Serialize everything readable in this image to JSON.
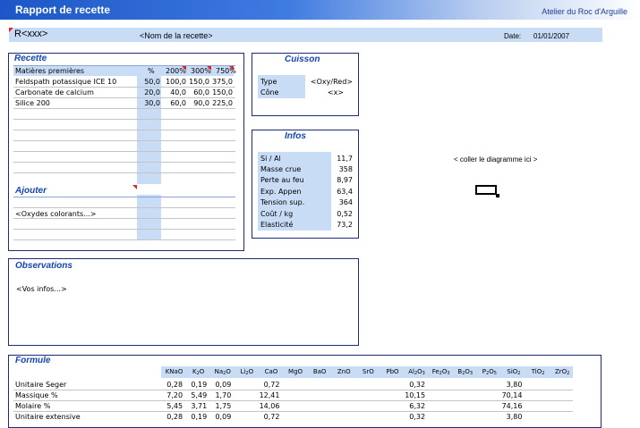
{
  "header": {
    "title": "Rapport de recette",
    "workshop": "Atelier du Roc d'Arguille"
  },
  "recipe_header": {
    "code": "R<xxx>",
    "name": "<Nom de la recette>",
    "date_label": "Date:",
    "date_value": "01/01/2007"
  },
  "recette": {
    "title": "Recette",
    "columns": [
      "Matières premières",
      "%",
      "200%",
      "300%",
      "750%"
    ],
    "rows": [
      [
        "Feldspath potassique ICE 10",
        "50,0",
        "100,0",
        "150,0",
        "375,0"
      ],
      [
        "Carbonate de calcium",
        "20,0",
        "40,0",
        "60,0",
        "150,0"
      ],
      [
        "Silice 200",
        "30,0",
        "60,0",
        "90,0",
        "225,0"
      ]
    ],
    "ajouter": {
      "title": "Ajouter",
      "placeholder": "<Oxydes colorants...>"
    }
  },
  "cuisson": {
    "title": "Cuisson",
    "rows": [
      [
        "Type",
        "<Oxy/Red>"
      ],
      [
        "Cône",
        "<x>"
      ]
    ]
  },
  "infos": {
    "title": "Infos",
    "rows": [
      [
        "Si / Al",
        "11,7"
      ],
      [
        "Masse crue",
        "358"
      ],
      [
        "Perte au feu",
        "8,97"
      ],
      [
        "Exp. Appen",
        "63,4"
      ],
      [
        "Tension sup.",
        "364"
      ],
      [
        "Coût / kg",
        "0,52"
      ],
      [
        "Elasticité",
        "73,2"
      ]
    ]
  },
  "diagram": {
    "placeholder": "< coller le diagramme ici >"
  },
  "observations": {
    "title": "Observations",
    "text": "<Vos infos...>"
  },
  "formule": {
    "title": "Formule",
    "columns": [
      {
        "base": "KNaO",
        "sub": ""
      },
      {
        "base": "K",
        "sub": "2",
        "tail": "O"
      },
      {
        "base": "Na",
        "sub": "2",
        "tail": "O"
      },
      {
        "base": "Li",
        "sub": "2",
        "tail": "O"
      },
      {
        "base": "CaO",
        "sub": ""
      },
      {
        "base": "MgO",
        "sub": ""
      },
      {
        "base": "BaO",
        "sub": ""
      },
      {
        "base": "ZnO",
        "sub": ""
      },
      {
        "base": "SrO",
        "sub": ""
      },
      {
        "base": "PbO",
        "sub": ""
      },
      {
        "base": "Al",
        "sub": "2",
        "tail": "O",
        "sub2": "3"
      },
      {
        "base": "Fe",
        "sub": "2",
        "tail": "O",
        "sub2": "3"
      },
      {
        "base": "B",
        "sub": "2",
        "tail": "O",
        "sub2": "3"
      },
      {
        "base": "P",
        "sub": "2",
        "tail": "O",
        "sub2": "5"
      },
      {
        "base": "SiO",
        "sub": "2"
      },
      {
        "base": "TiO",
        "sub": "2"
      },
      {
        "base": "ZrO",
        "sub": "2"
      }
    ],
    "rows": [
      {
        "label": "Unitaire Seger",
        "values": [
          "0,28",
          "0,19",
          "0,09",
          "",
          "0,72",
          "",
          "",
          "",
          "",
          "",
          "0,32",
          "",
          "",
          "",
          "3,80",
          "",
          ""
        ]
      },
      {
        "label": "Massique %",
        "values": [
          "7,20",
          "5,49",
          "1,70",
          "",
          "12,41",
          "",
          "",
          "",
          "",
          "",
          "10,15",
          "",
          "",
          "",
          "70,14",
          "",
          ""
        ]
      },
      {
        "label": "Molaire %",
        "values": [
          "5,45",
          "3,71",
          "1,75",
          "",
          "14,06",
          "",
          "",
          "",
          "",
          "",
          "6,32",
          "",
          "",
          "",
          "74,16",
          "",
          ""
        ]
      },
      {
        "label": "Unitaire extensive",
        "values": [
          "0,28",
          "0,19",
          "0,09",
          "",
          "0,72",
          "",
          "",
          "",
          "",
          "",
          "0,32",
          "",
          "",
          "",
          "3,80",
          "",
          ""
        ]
      }
    ]
  }
}
